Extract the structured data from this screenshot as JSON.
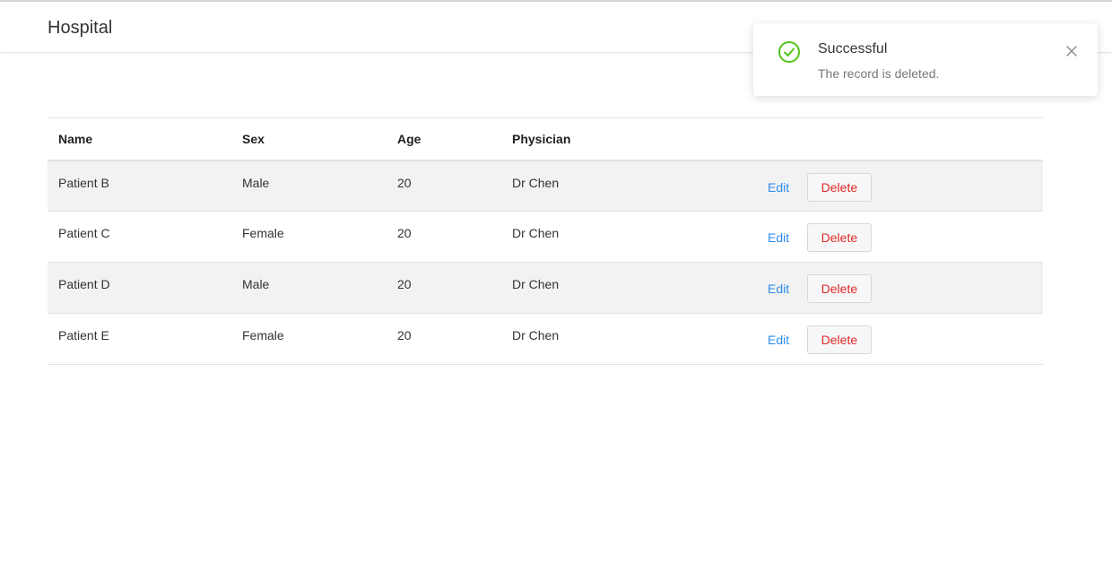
{
  "app": {
    "title": "Hospital"
  },
  "table": {
    "headers": {
      "name": "Name",
      "sex": "Sex",
      "age": "Age",
      "physician": "Physician"
    },
    "rows": [
      {
        "name": "Patient B",
        "sex": "Male",
        "age": "20",
        "physician": "Dr Chen",
        "edit_label": "Edit",
        "delete_label": "Delete"
      },
      {
        "name": "Patient C",
        "sex": "Female",
        "age": "20",
        "physician": "Dr Chen",
        "edit_label": "Edit",
        "delete_label": "Delete"
      },
      {
        "name": "Patient D",
        "sex": "Male",
        "age": "20",
        "physician": "Dr Chen",
        "edit_label": "Edit",
        "delete_label": "Delete"
      },
      {
        "name": "Patient E",
        "sex": "Female",
        "age": "20",
        "physician": "Dr Chen",
        "edit_label": "Edit",
        "delete_label": "Delete"
      }
    ]
  },
  "notification": {
    "title": "Successful",
    "message": "The record is deleted.",
    "icon": "check-circle-icon",
    "close_icon": "close-icon",
    "accent_color": "#52c41a"
  },
  "colors": {
    "link": "#2d8cf0",
    "danger": "#e02a2a",
    "row_alt": "#f2f2f2"
  }
}
